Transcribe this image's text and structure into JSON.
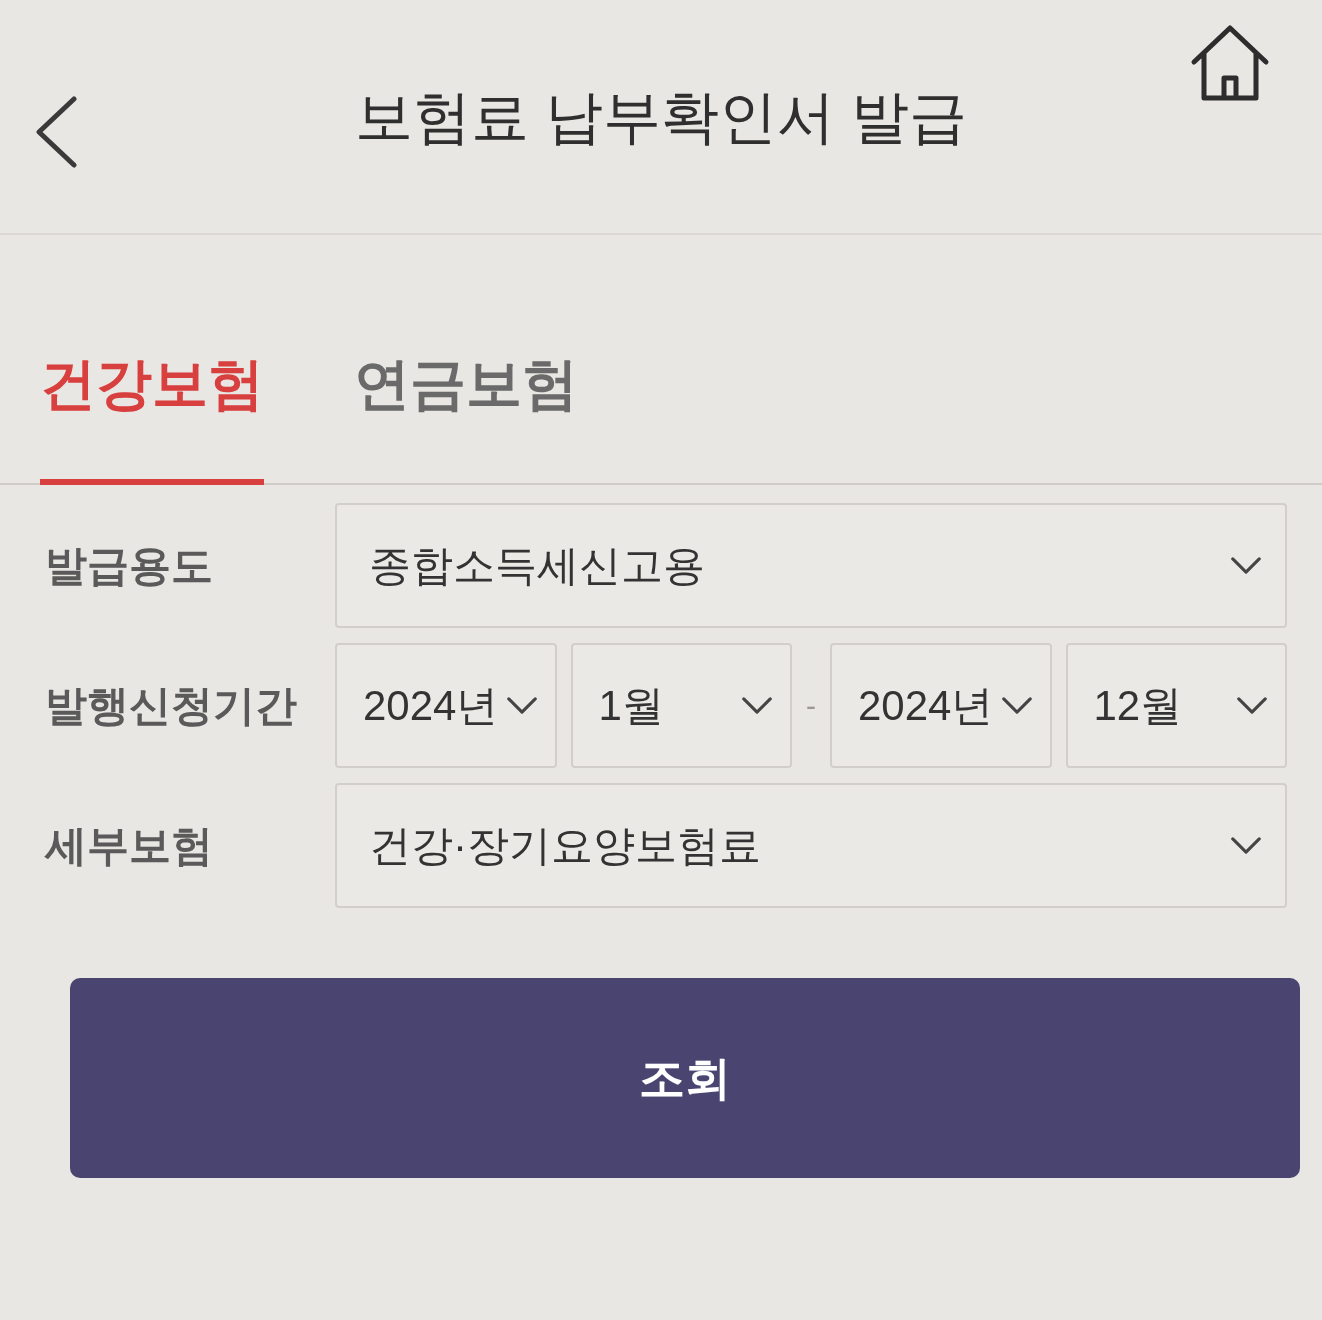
{
  "header": {
    "title": "보험료 납부확인서 발급"
  },
  "tabs": [
    {
      "label": "건강보험",
      "selected": true
    },
    {
      "label": "연금보험",
      "selected": false
    }
  ],
  "form": [
    {
      "label": "발급용도",
      "fields": [
        {
          "kind": "select",
          "value": "종합소득세신고용"
        }
      ]
    },
    {
      "label": "발행신청기간",
      "fields": [
        {
          "kind": "select",
          "value": "2024년"
        },
        {
          "kind": "select",
          "value": "1월"
        },
        {
          "kind": "separator",
          "text": "-"
        },
        {
          "kind": "select",
          "value": "2024년"
        },
        {
          "kind": "select",
          "value": "12월"
        }
      ]
    },
    {
      "label": "세부보험",
      "fields": [
        {
          "kind": "select",
          "value": "건강·장기요양보험료"
        }
      ]
    }
  ],
  "submit_button": {
    "label": "조회"
  }
}
